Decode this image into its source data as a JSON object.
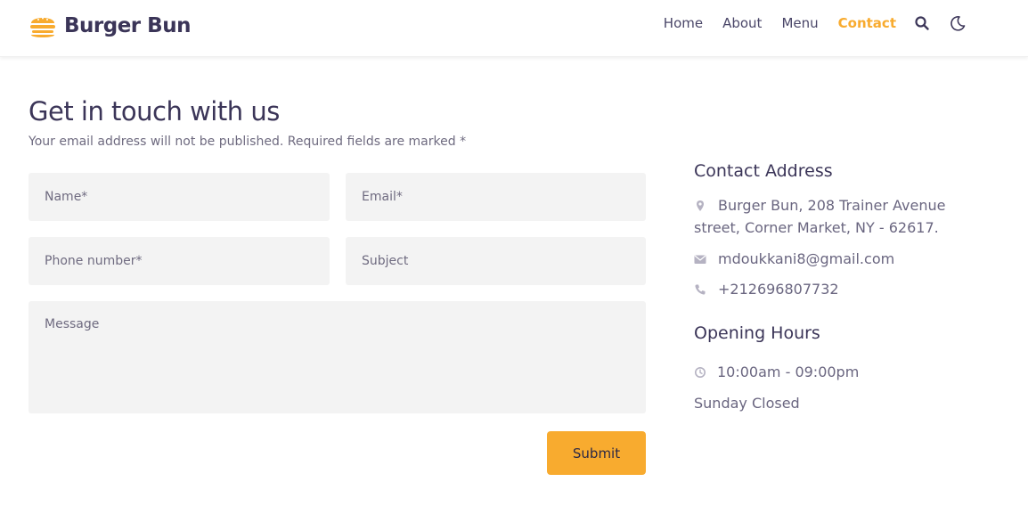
{
  "header": {
    "brand": "Burger Bun",
    "nav": [
      "Home",
      "About",
      "Menu",
      "Contact"
    ],
    "active_nav": "Contact",
    "icons": [
      "search-icon",
      "moon-icon"
    ]
  },
  "colors": {
    "accent": "#f8ab2f",
    "text": "#3b3558",
    "muted": "#6a6680",
    "field_bg": "#f3f3f3"
  },
  "form": {
    "title": "Get in touch with us",
    "subtitle": "Your email address will not be published. Required fields are marked *",
    "name_placeholder": "Name*",
    "email_placeholder": "Email*",
    "phone_placeholder": "Phone number*",
    "subject_placeholder": "Subject",
    "message_placeholder": "Message",
    "submit_label": "Submit"
  },
  "contact": {
    "address_heading": "Contact Address",
    "address_line1": "Burger Bun, 208 Trainer Avenue",
    "address_line2": "street, Corner Market, NY - 62617.",
    "email": "mdoukkani8@gmail.com",
    "phone": "+212696807732",
    "hours_heading": "Opening Hours",
    "hours": "10:00am - 09:00pm",
    "closed": "Sunday Closed"
  }
}
